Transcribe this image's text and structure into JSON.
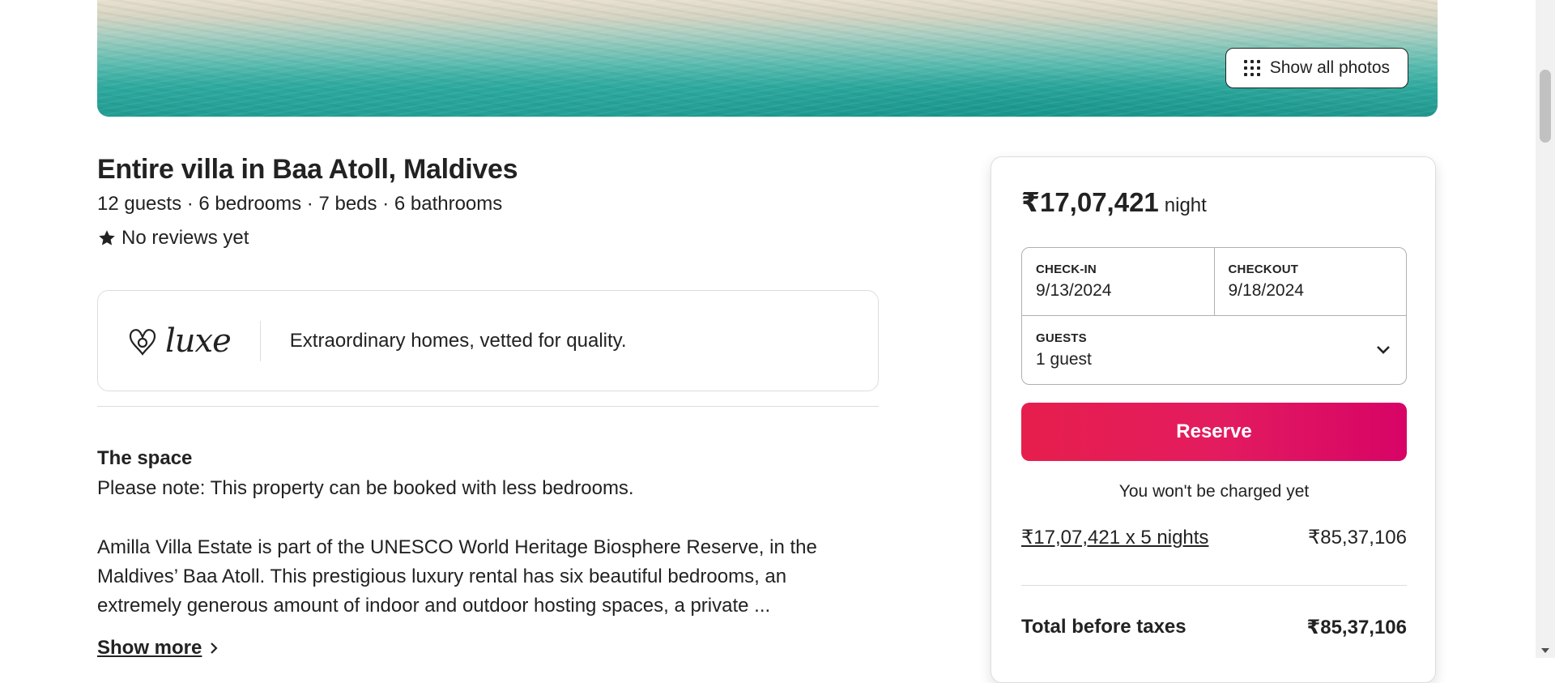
{
  "hero": {
    "show_photos_label": "Show all photos"
  },
  "listing": {
    "title": "Entire villa in Baa Atoll, Maldives",
    "subtitle": "12 guests · 6 bedrooms · 7 beds · 6 bathrooms",
    "reviews": "No reviews yet"
  },
  "luxe": {
    "wordmark": "luxe",
    "tagline": "Extraordinary homes, vetted for quality."
  },
  "space": {
    "heading": "The space",
    "note": "Please note: This property can be booked with less bedrooms.",
    "description": "Amilla Villa Estate is part of the UNESCO World Heritage Biosphere Reserve, in the Maldives’ Baa Atoll. This prestigious luxury rental has six beautiful bedrooms, an extremely generous amount of indoor and outdoor hosting spaces, a private ...",
    "show_more": "Show more"
  },
  "booking": {
    "price": "₹17,07,421",
    "per": "night",
    "checkin_label": "CHECK-IN",
    "checkin_value": "9/13/2024",
    "checkout_label": "CHECKOUT",
    "checkout_value": "9/18/2024",
    "guests_label": "GUESTS",
    "guests_value": "1 guest",
    "reserve_label": "Reserve",
    "no_charge": "You won't be charged yet",
    "line_label": "₹17,07,421 x 5 nights",
    "line_value": "₹85,37,106",
    "total_label": "Total before taxes",
    "total_value": "₹85,37,106",
    "accent_color": "#e31c5f"
  }
}
